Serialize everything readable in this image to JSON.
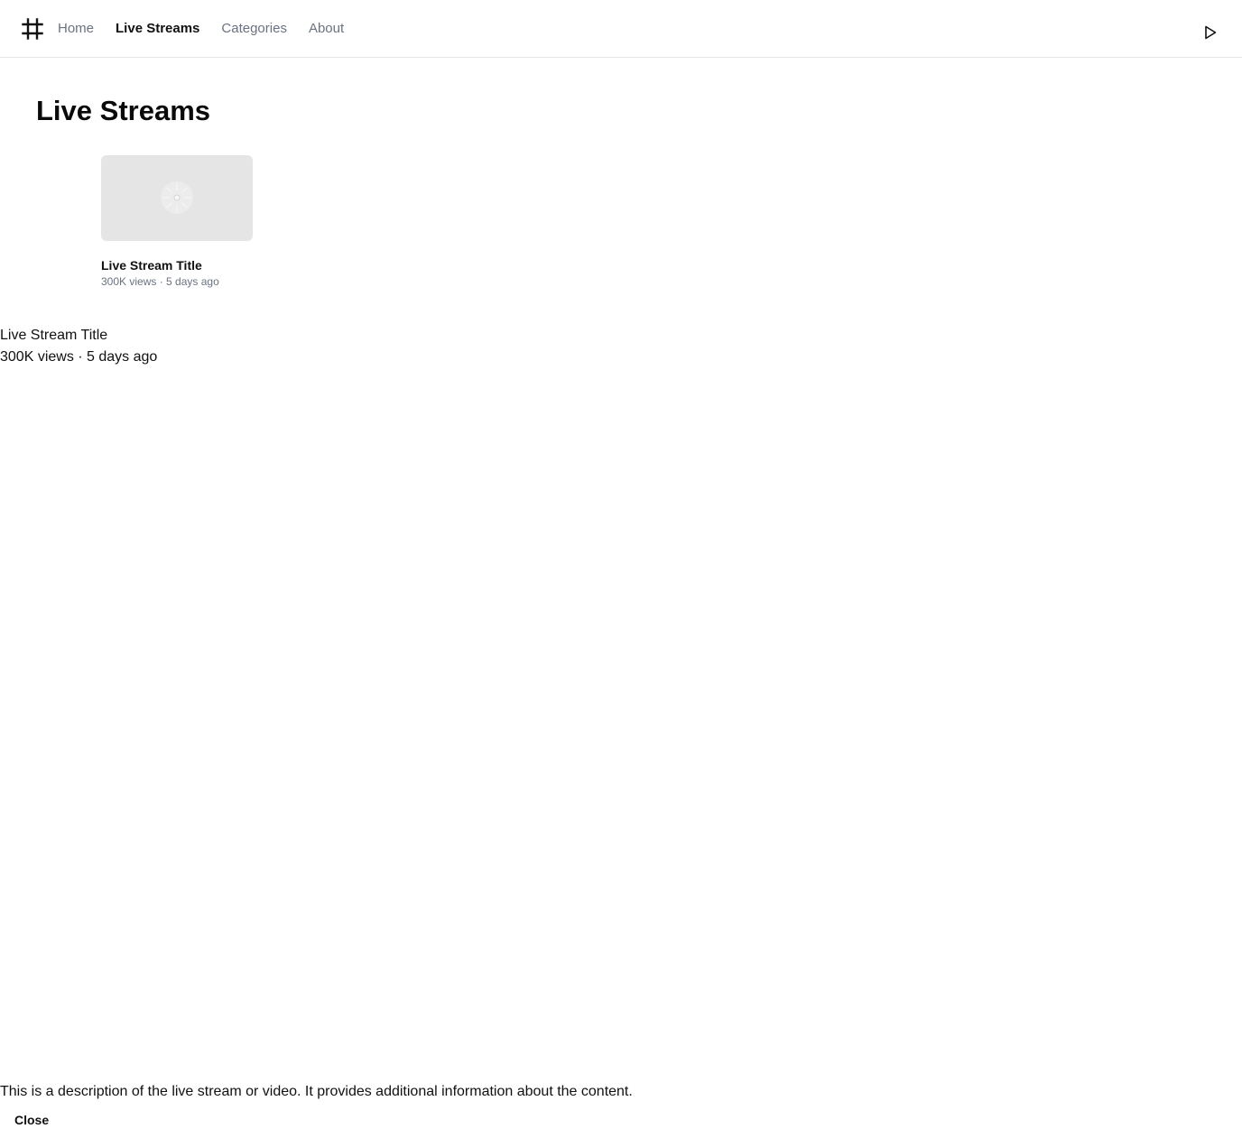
{
  "header": {
    "nav": [
      {
        "label": "Home",
        "active": false
      },
      {
        "label": "Live Streams",
        "active": true
      },
      {
        "label": "Categories",
        "active": false
      },
      {
        "label": "About",
        "active": false
      }
    ],
    "logo_icon": "hash-icon",
    "action_icon": "play-icon"
  },
  "page": {
    "title": "Live Streams"
  },
  "streams": [
    {
      "title": "Live Stream Title",
      "meta": "300K views · 5 days ago",
      "thumbnail_icon": "loading-spinner-icon"
    }
  ],
  "detail": {
    "title": "Live Stream Title",
    "meta": "300K views · 5 days ago",
    "description": "This is a description of the live stream or video. It provides additional information about the content.",
    "close_label": "Close"
  },
  "colors": {
    "background": "#ffffff",
    "text": "#111111",
    "muted": "#6b7280",
    "thumbnail": "#e5e5e5",
    "border": "#e5e7eb"
  }
}
